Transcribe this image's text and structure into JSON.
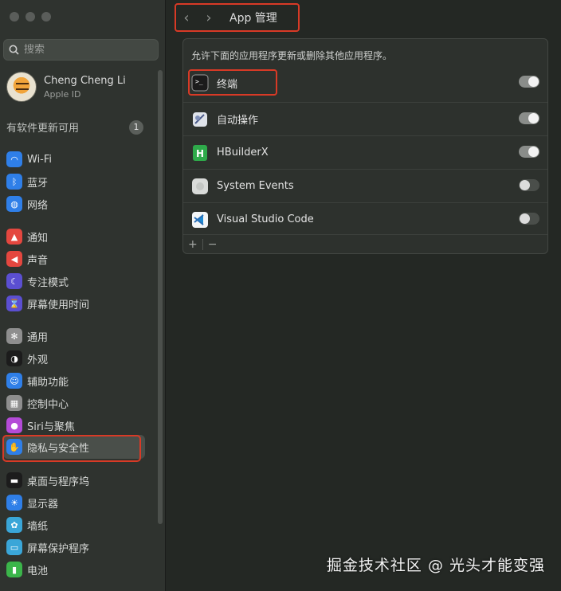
{
  "sidebar": {
    "search_placeholder": "搜索",
    "profile": {
      "name": "Cheng Cheng Li",
      "sub": "Apple ID"
    },
    "update": {
      "label": "有软件更新可用",
      "count": "1"
    },
    "items": [
      {
        "label": "Wi-Fi",
        "icon": "wifi-icon",
        "color": "#2f7fe8"
      },
      {
        "label": "蓝牙",
        "icon": "bluetooth-icon",
        "color": "#2f7fe8"
      },
      {
        "label": "网络",
        "icon": "globe-icon",
        "color": "#2f7fe8"
      },
      {
        "label": "通知",
        "icon": "bell-icon",
        "color": "#e4473f"
      },
      {
        "label": "声音",
        "icon": "speaker-icon",
        "color": "#e4473f"
      },
      {
        "label": "专注模式",
        "icon": "moon-icon",
        "color": "#5b4fd1"
      },
      {
        "label": "屏幕使用时间",
        "icon": "hourglass-icon",
        "color": "#5b4fd1"
      },
      {
        "label": "通用",
        "icon": "gear-icon",
        "color": "#8e8e8e"
      },
      {
        "label": "外观",
        "icon": "appearance-icon",
        "color": "#1c1c1c"
      },
      {
        "label": "辅助功能",
        "icon": "accessibility-icon",
        "color": "#2f7fe8"
      },
      {
        "label": "控制中心",
        "icon": "control-center-icon",
        "color": "#8e8e8e"
      },
      {
        "label": "Siri与聚焦",
        "icon": "siri-icon",
        "color": "#b44bd8"
      },
      {
        "label": "隐私与安全性",
        "icon": "hand-icon",
        "color": "#2f7fe8"
      },
      {
        "label": "桌面与程序坞",
        "icon": "dock-icon",
        "color": "#1c1c1c"
      },
      {
        "label": "显示器",
        "icon": "sun-icon",
        "color": "#2f7fe8"
      },
      {
        "label": "墙纸",
        "icon": "flower-icon",
        "color": "#3aa6d8"
      },
      {
        "label": "屏幕保护程序",
        "icon": "screensaver-icon",
        "color": "#3aa6d8"
      },
      {
        "label": "电池",
        "icon": "battery-icon",
        "color": "#3bb54a"
      }
    ]
  },
  "header": {
    "back": "‹",
    "forward": "›",
    "title": "App 管理"
  },
  "panel": {
    "description": "允许下面的应用程序更新或删除其他应用程序。",
    "apps": [
      {
        "name": "终端",
        "icon": "terminal-icon",
        "enabled": true
      },
      {
        "name": "自动操作",
        "icon": "automator-icon",
        "enabled": true
      },
      {
        "name": "HBuilderX",
        "icon": "hbuilderx-icon",
        "enabled": true
      },
      {
        "name": "System Events",
        "icon": "system-events-icon",
        "enabled": false
      },
      {
        "name": "Visual Studio Code",
        "icon": "vscode-icon",
        "enabled": false
      }
    ],
    "add": "+",
    "remove": "−"
  },
  "watermark": "掘金技术社区 @ 光头才能变强"
}
